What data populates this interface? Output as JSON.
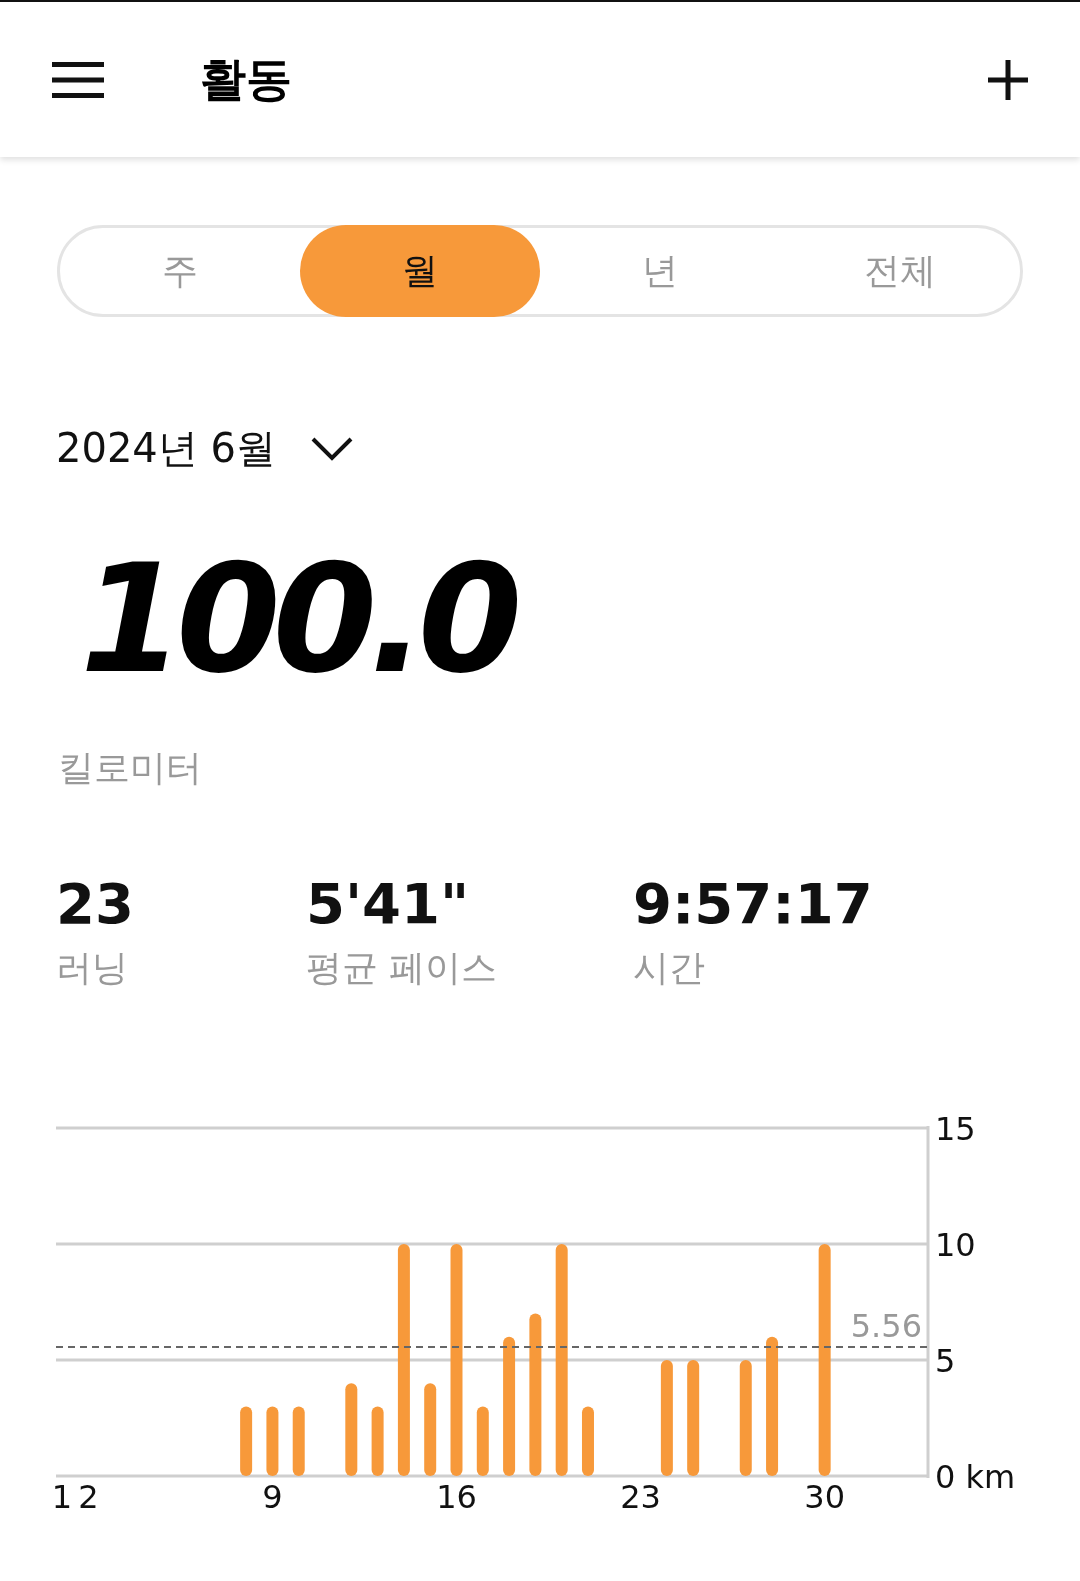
{
  "header": {
    "title": "활동"
  },
  "tabs": [
    {
      "label": "주",
      "selected": false
    },
    {
      "label": "월",
      "selected": true
    },
    {
      "label": "년",
      "selected": false
    },
    {
      "label": "전체",
      "selected": false
    }
  ],
  "period": {
    "label": "2024년 6월"
  },
  "total": {
    "value": "100.0",
    "unit": "킬로미터"
  },
  "stats": [
    {
      "value": "23",
      "label": "러닝"
    },
    {
      "value": "5'41\"",
      "label": "평균 페이스"
    },
    {
      "value": "9:57:17",
      "label": "시간"
    }
  ],
  "chart": {
    "chart_data": {
      "type": "bar",
      "x": [
        8,
        9,
        10,
        12,
        13,
        14,
        15,
        16,
        17,
        18,
        19,
        20,
        21,
        24,
        25,
        27,
        28,
        30
      ],
      "series": [
        {
          "color": "#f7993a",
          "values": [
            3,
            3,
            3,
            4,
            3,
            10,
            4,
            10,
            3,
            6,
            7,
            10,
            3,
            5,
            5,
            5,
            6,
            10
          ]
        }
      ],
      "xlim": [
        0.77,
        33.93
      ],
      "ylim": [
        0,
        15
      ],
      "xticks": [
        1,
        2,
        9,
        16,
        23,
        30
      ],
      "yticks": [
        {
          "value": 0,
          "label": "0 km"
        },
        5,
        10,
        15
      ],
      "ref_lines": [
        {
          "axis": "y",
          "value": 5.56,
          "label": "5.56"
        }
      ]
    }
  }
}
